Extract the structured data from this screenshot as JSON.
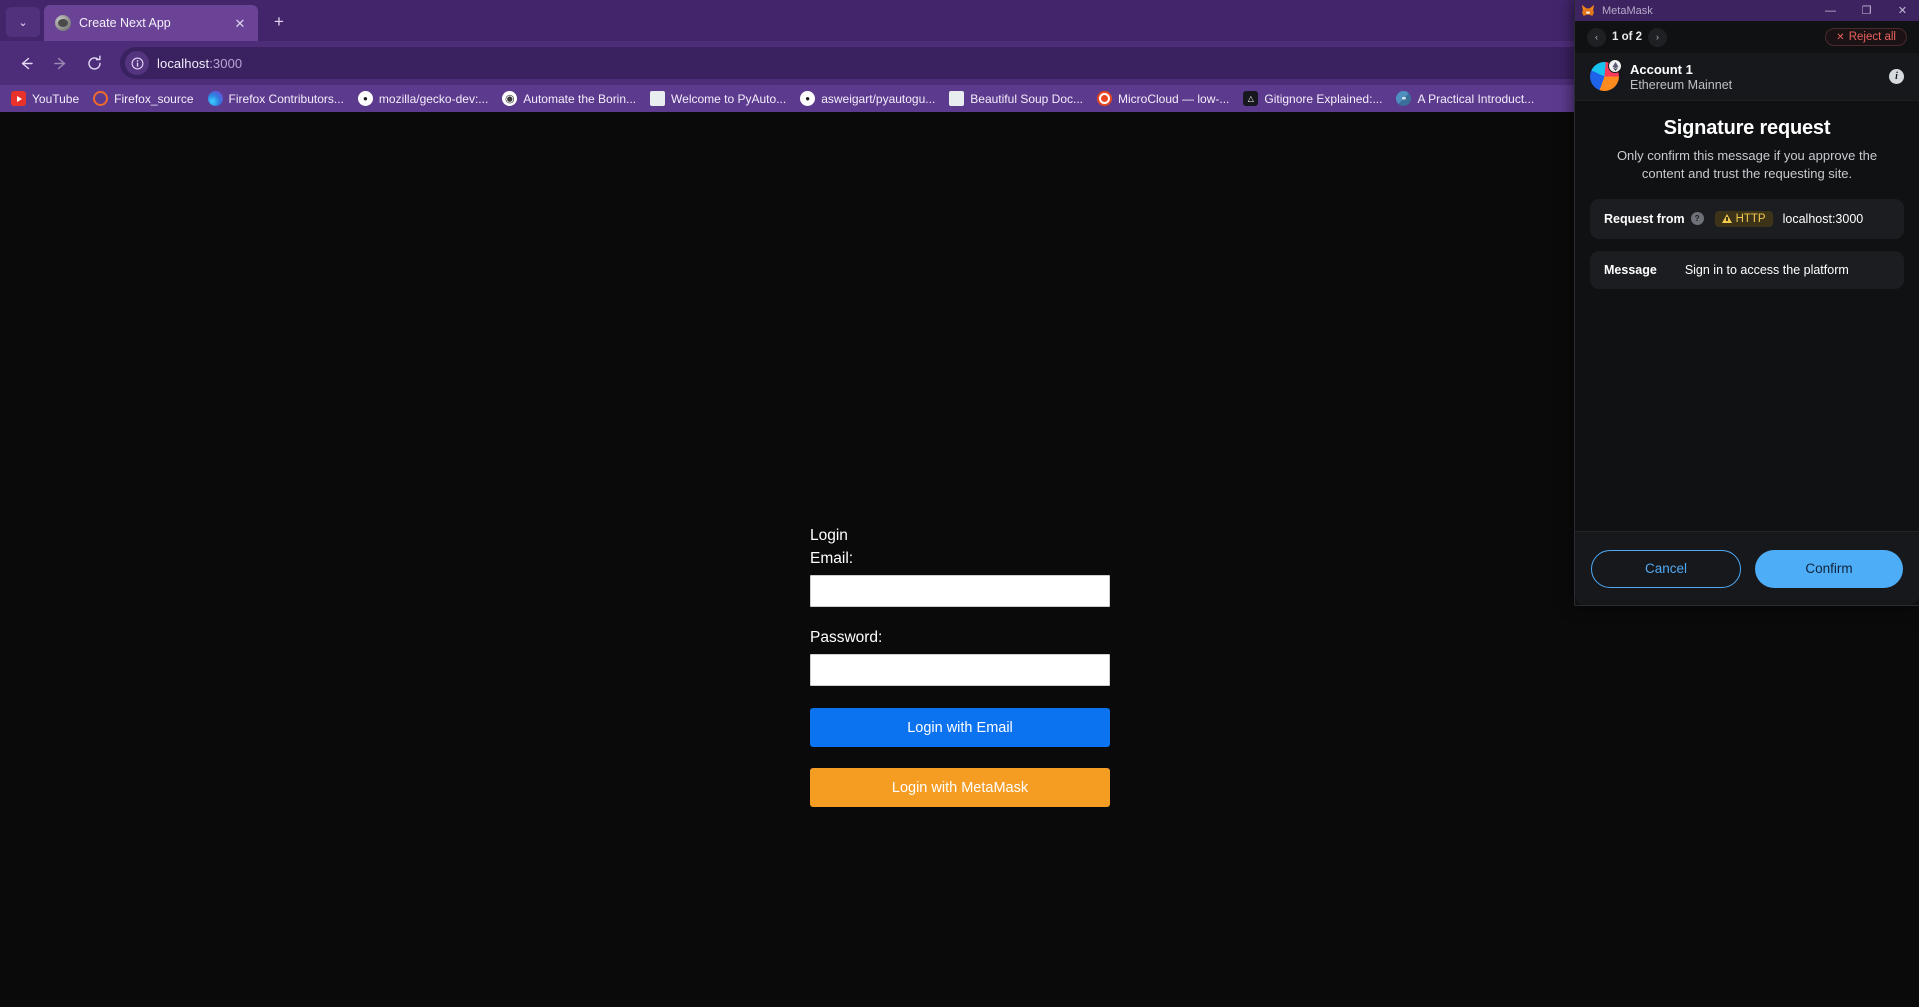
{
  "browser": {
    "tab": {
      "title": "Create Next App",
      "close_label": "✕",
      "favicon_name": "nextjs-favicon"
    },
    "tablist_label": "⌄",
    "newtab_label": "+",
    "nav": {
      "back_label": "←",
      "forward_label": "→",
      "reload_label": "↻"
    },
    "url": {
      "host": "localhost",
      "port": ":3000",
      "full": "localhost:3000"
    },
    "bookmarks": [
      {
        "label": "YouTube",
        "icon": "youtube-icon"
      },
      {
        "label": "Firefox_source",
        "icon": "firefox-source-icon"
      },
      {
        "label": "Firefox Contributors...",
        "icon": "firefox-contributors-icon"
      },
      {
        "label": "mozilla/gecko-dev:...",
        "icon": "github-icon"
      },
      {
        "label": "Automate the Borin...",
        "icon": "globe-icon"
      },
      {
        "label": "Welcome to PyAuto...",
        "icon": "readthedocs-icon"
      },
      {
        "label": "asweigart/pyautogu...",
        "icon": "github-icon"
      },
      {
        "label": "Beautiful Soup Doc...",
        "icon": "readthedocs-icon"
      },
      {
        "label": "MicroCloud — low-...",
        "icon": "microcloud-icon"
      },
      {
        "label": "Gitignore Explained:...",
        "icon": "dark-icon"
      },
      {
        "label": "A Practical Introduct...",
        "icon": "python-icon"
      }
    ]
  },
  "page": {
    "form": {
      "title": "Login",
      "email_label": "Email:",
      "email_value": "",
      "email_placeholder": "",
      "password_label": "Password:",
      "password_value": "",
      "password_placeholder": "",
      "email_button": "Login with Email",
      "metamask_button": "Login with MetaMask"
    }
  },
  "metamask": {
    "window_title": "MetaMask",
    "window_controls": {
      "minimize": "—",
      "maximize": "❐",
      "close": "✕"
    },
    "nav": {
      "prev": "‹",
      "next": "›",
      "counter": "1 of 2",
      "reject_all": "Reject all",
      "reject_x": "✕"
    },
    "account": {
      "name": "Account 1",
      "network": "Ethereum Mainnet",
      "info_label": "i"
    },
    "signature": {
      "title": "Signature request",
      "subtitle": "Only confirm this message if you approve the content and trust the requesting site.",
      "request_from_label": "Request from",
      "request_help": "?",
      "http_badge": "HTTP",
      "request_host": "localhost:3000",
      "message_label": "Message",
      "message_value": "Sign in to access the platform"
    },
    "footer": {
      "cancel": "Cancel",
      "confirm": "Confirm"
    },
    "colors": {
      "accent": "#4dadf7",
      "danger": "#e8615c",
      "warning": "#f2c94c",
      "panel_bg": "#101113",
      "card_bg": "#1c1d21"
    }
  },
  "colors": {
    "browser_chrome": "#4d2d7a",
    "tabstrip": "#42256b",
    "bookmarks_bar": "#5c3a8e",
    "page_bg": "#0a0a0a",
    "primary_button": "#0b72f0",
    "metamask_button": "#f59c22"
  }
}
